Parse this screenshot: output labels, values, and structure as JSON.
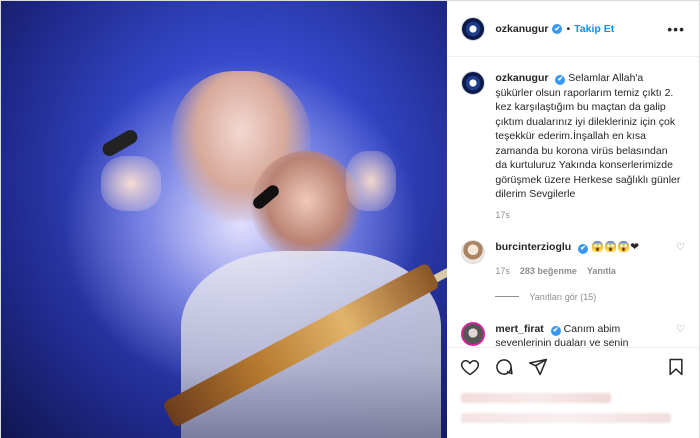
{
  "post": {
    "username": "ozkanugur",
    "verified_mark": "✔",
    "separator": "•",
    "follow_label": "Takip Et",
    "more_label": "•••"
  },
  "caption": {
    "username": "ozkanugur",
    "text": "Selamlar Allah'a şükürler olsun raporlarım temiz çıktı 2. kez karşılaştığım bu maçtan da galip çıktım dualarınız iyi dilekleriniz için çok teşekkür ederim.İnşallah en kısa zamanda bu korona virüs belasından da kurtuluruz Yakında konserlerimizde görüşmek üzere Herkese sağlıklı günler dilerim Sevgilerle",
    "time": "17s"
  },
  "comments": [
    {
      "username": "burcinterzioglu",
      "text": "😱😱😱❤",
      "time": "17s",
      "likes": "283 beğenme",
      "reply_label": "Yanıtla",
      "view_replies": "Yanıtları gör (15)"
    },
    {
      "username": "mert_firat",
      "text": "Canım abim sevenlerinin duaları ve senin"
    }
  ],
  "icons": {
    "heart": "heart-icon",
    "comment": "comment-icon",
    "share": "share-icon",
    "save": "bookmark-icon"
  },
  "colors": {
    "accent": "#0095f6",
    "verified": "#3897f0",
    "muted": "#8e8e8e"
  }
}
